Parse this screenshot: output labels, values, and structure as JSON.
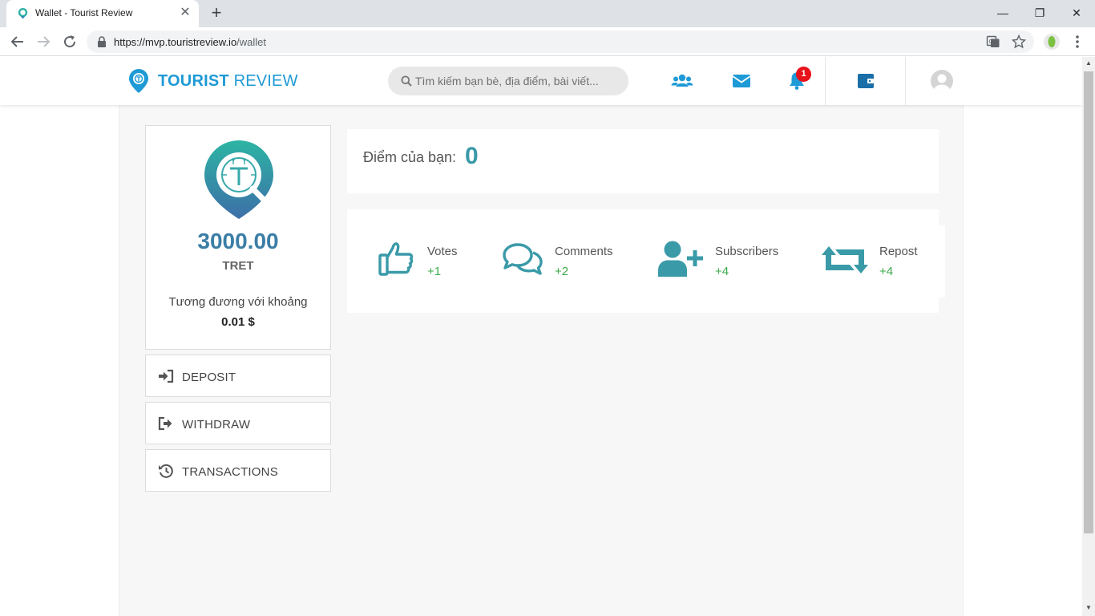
{
  "browser": {
    "tab_title": "Wallet - Tourist Review",
    "tab_close": "✕",
    "new_tab": "+",
    "url_domain": "https://mvp.touristreview.io",
    "url_path": "/wallet",
    "minimize": "—",
    "maximize": "❐",
    "close": "✕"
  },
  "header": {
    "logo_bold": "TOURIST",
    "logo_light": "REVIEW",
    "search_placeholder": "Tìm kiếm bạn bè, địa điểm, bài viết...",
    "notification_count": "1"
  },
  "wallet": {
    "balance": "3000.00",
    "unit": "TRET",
    "equiv_label": "Tương đương với khoảng",
    "equiv_value": "0.01 $"
  },
  "actions": {
    "deposit": "DEPOSIT",
    "withdraw": "WITHDRAW",
    "transactions": "TRANSACTIONS"
  },
  "points": {
    "label": "Điểm của bạn:",
    "value": "0"
  },
  "stats": [
    {
      "name": "Votes",
      "value": "+1"
    },
    {
      "name": "Comments",
      "value": "+2"
    },
    {
      "name": "Subscribers",
      "value": "+4"
    },
    {
      "name": "Repost",
      "value": "+4"
    }
  ],
  "colors": {
    "brand_blue": "#1e9ad6",
    "teal": "#3a9aa8",
    "positive_green": "#3bab4a",
    "badge_red": "#e8121b"
  },
  "icons": [
    "users-icon",
    "envelope-icon",
    "bell-icon",
    "wallet-icon",
    "avatar-icon",
    "thumbs-up-icon",
    "comments-icon",
    "user-plus-icon",
    "retweet-icon",
    "sign-in-icon",
    "sign-out-icon",
    "history-icon"
  ]
}
